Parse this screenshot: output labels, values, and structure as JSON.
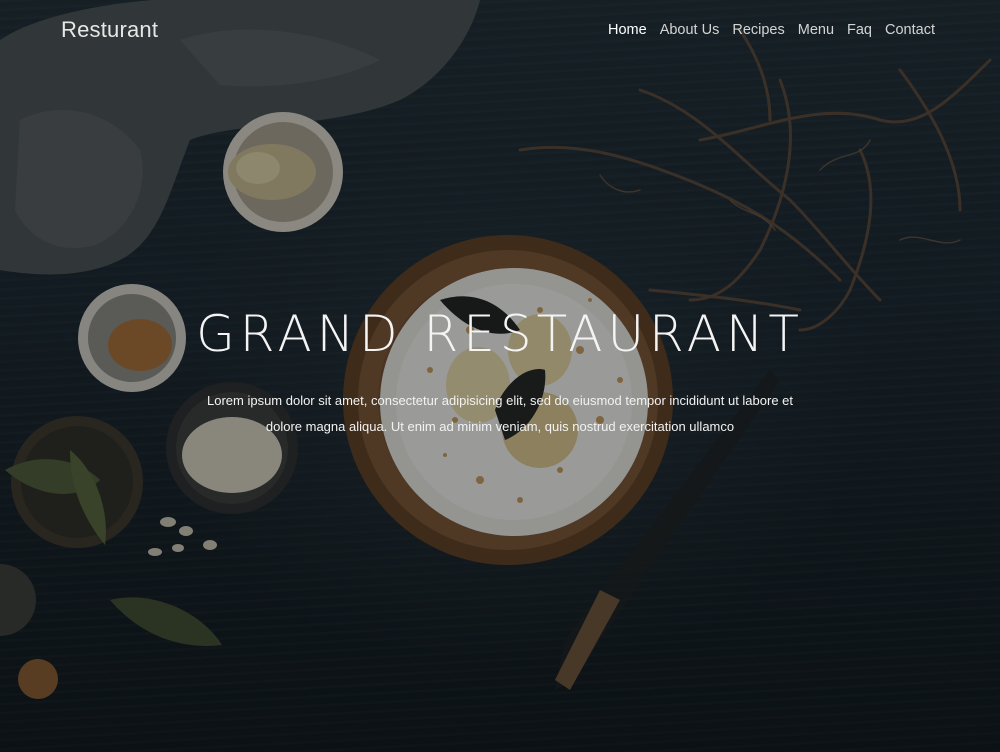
{
  "brand": {
    "name": "Resturant"
  },
  "nav": {
    "items": [
      {
        "label": "Home",
        "active": true
      },
      {
        "label": "About Us",
        "active": false
      },
      {
        "label": "Recipes",
        "active": false
      },
      {
        "label": "Menu",
        "active": false
      },
      {
        "label": "Faq",
        "active": false
      },
      {
        "label": "Contact",
        "active": false
      }
    ]
  },
  "hero": {
    "title": "GRAND RESTAURANT",
    "subtitle": "Lorem ipsum dolor sit amet, consectetur adipisicing elit, sed do eiusmod tempor incididunt ut labore et dolore magna aliqua. Ut enim ad minim veniam, quis nostrud exercitation ullamco"
  },
  "colors": {
    "background": "#17222a",
    "nav_text": "#d4d4d4",
    "nav_active": "#ffffff",
    "headline": "#f4f4f4"
  }
}
